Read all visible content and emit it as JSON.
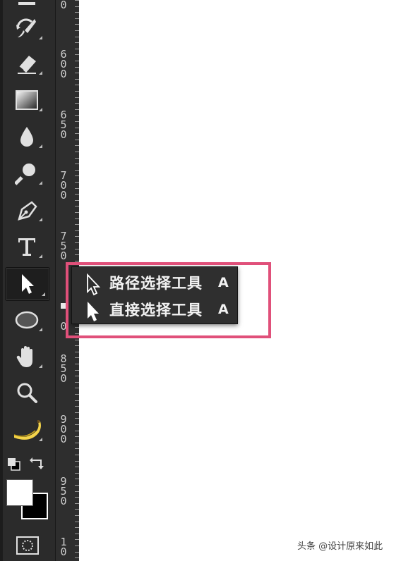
{
  "toolbar": {
    "tools": [
      {
        "name": "brush-tool",
        "icon": "brush-icon"
      },
      {
        "name": "history-brush-tool",
        "icon": "history-brush-icon"
      },
      {
        "name": "eraser-tool",
        "icon": "eraser-icon"
      },
      {
        "name": "gradient-tool",
        "icon": "gradient-icon"
      },
      {
        "name": "blur-tool",
        "icon": "drop-icon"
      },
      {
        "name": "dodge-tool",
        "icon": "dodge-icon"
      },
      {
        "name": "pen-tool",
        "icon": "pen-nib-icon"
      },
      {
        "name": "type-tool",
        "icon": "type-icon",
        "glyph": "T"
      },
      {
        "name": "path-selection-tool",
        "icon": "arrow-cursor-icon",
        "active": true
      },
      {
        "name": "ellipse-tool",
        "icon": "ellipse-icon"
      },
      {
        "name": "hand-tool",
        "icon": "hand-icon"
      },
      {
        "name": "zoom-tool",
        "icon": "magnifier-icon"
      },
      {
        "name": "banana-tool",
        "icon": "banana-icon"
      }
    ],
    "colors": {
      "foreground": "#ffffff",
      "background": "#000000"
    }
  },
  "ruler": {
    "labels": [
      [
        "5",
        "0"
      ],
      [
        "6",
        "0",
        "0"
      ],
      [
        "6",
        "5",
        "0"
      ],
      [
        "7",
        "0",
        "0"
      ],
      [
        "7",
        "5",
        "0"
      ],
      [
        "0"
      ],
      [
        "8",
        "5",
        "0"
      ],
      [
        "9",
        "0",
        "0"
      ],
      [
        "9",
        "5",
        "0"
      ],
      [
        "1",
        "0"
      ]
    ]
  },
  "flyout": {
    "items": [
      {
        "label": "路径选择工具",
        "shortcut": "A",
        "icon": "hollow-arrow-icon"
      },
      {
        "label": "直接选择工具",
        "shortcut": "A",
        "icon": "solid-arrow-icon"
      }
    ]
  },
  "highlight": {
    "color": "#e0507a"
  },
  "watermark": {
    "text": "头条 @设计原来如此"
  }
}
